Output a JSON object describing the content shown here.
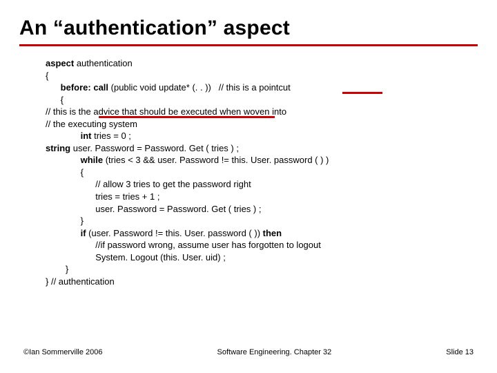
{
  "title": "An “authentication” aspect",
  "code": {
    "l0_pre": "",
    "l0_kw": "aspect",
    "l0_rest": " authentication",
    "l1": "{",
    "l2_pad": "      ",
    "l2_kw": "before: call",
    "l2_rest": " (public void update* (. . ))   // this is a pointcut",
    "l3": "      {",
    "l4": "// this is the advice that should be executed when woven into",
    "l5": "// the executing system",
    "l6_pad": "              ",
    "l6_kw": "int",
    "l6_rest": " tries = 0 ;",
    "l7_kw": "string",
    "l7_rest": " user. Password = Password. Get ( tries ) ;",
    "l8_pad": "              ",
    "l8_kw": "while",
    "l8_rest": " (tries < 3 && user. Password != this. User. password ( ) )",
    "l9": "              {",
    "l10": "                    // allow 3 tries to get the password right",
    "l11": "                    tries = tries + 1 ;",
    "l12": "                    user. Password = Password. Get ( tries ) ;",
    "l13": "              }",
    "l14_pad": "              ",
    "l14_kw": "if",
    "l14_mid": " (user. Password != this. User. password ( )) ",
    "l14_kw2": "then",
    "l15": "                    //if password wrong, assume user has forgotten to logout",
    "l16": "                    System. Logout (this. User. uid) ;",
    "l17": "        }",
    "l18": "} // authentication"
  },
  "footer": {
    "left": "©Ian Sommerville 2006",
    "center": "Software Engineering. Chapter 32",
    "right": "Slide 13"
  }
}
